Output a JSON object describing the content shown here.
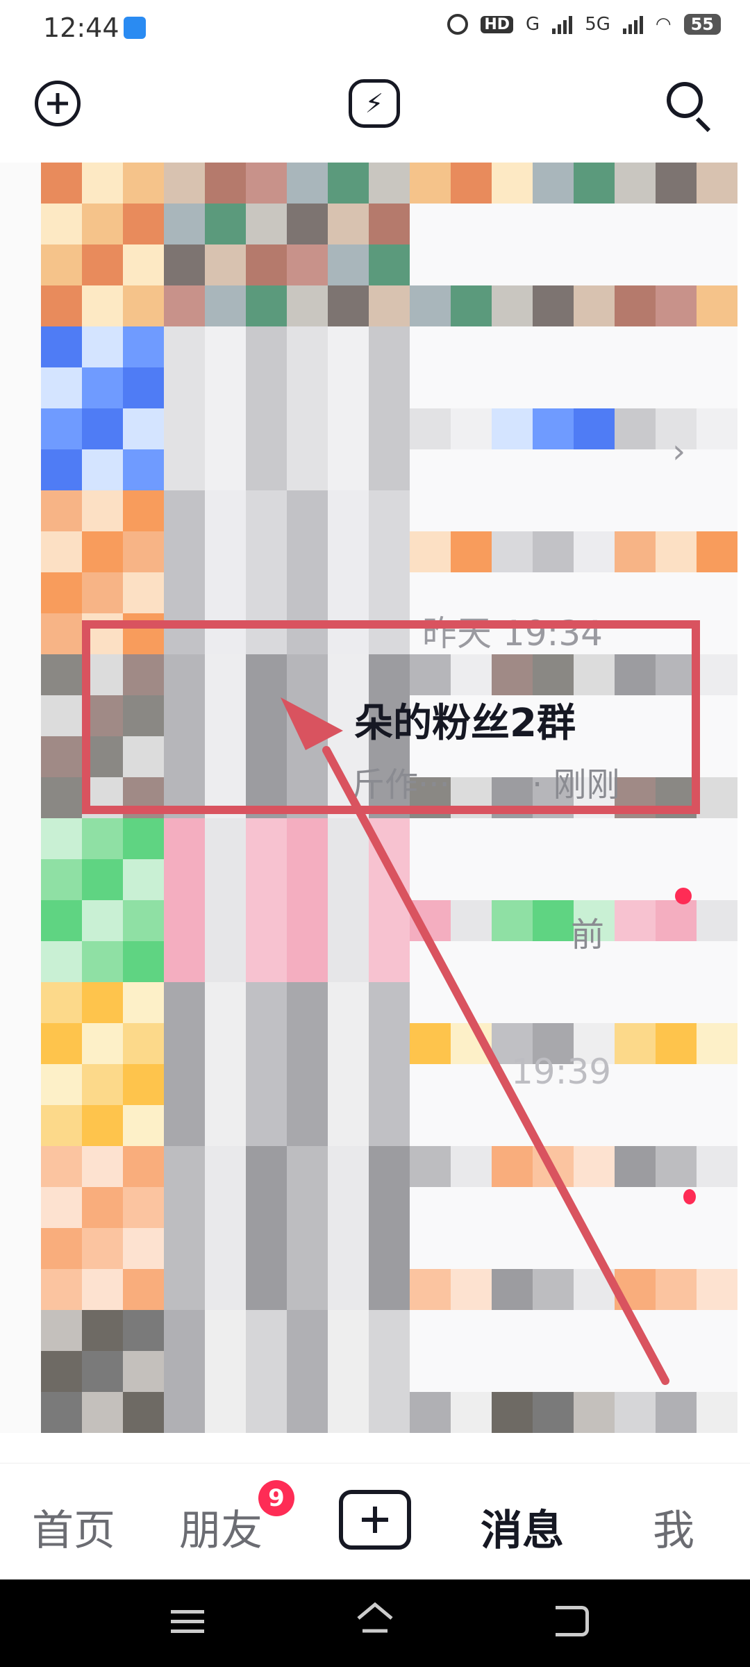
{
  "status_bar": {
    "time": "12:44",
    "hd_label": "HD",
    "net1": "G",
    "net2": "5G",
    "battery": "55"
  },
  "header": {
    "add_icon": "plus-circle-icon",
    "flash_icon": "lightning-icon",
    "search_icon": "search-icon"
  },
  "list": {
    "date_label": "昨天 19:34",
    "group_name": "朵的粉丝2群",
    "group_preview": "斤作···",
    "group_time": "· 刚刚",
    "ago_label": "前",
    "time2": "19:39",
    "chevron": "›"
  },
  "bottom_nav": {
    "home": "首页",
    "friends": "朋友",
    "friends_badge": "9",
    "messages": "消息",
    "me": "我"
  },
  "colors": {
    "accent": "#fe2c55",
    "highlight": "#d9535f"
  }
}
